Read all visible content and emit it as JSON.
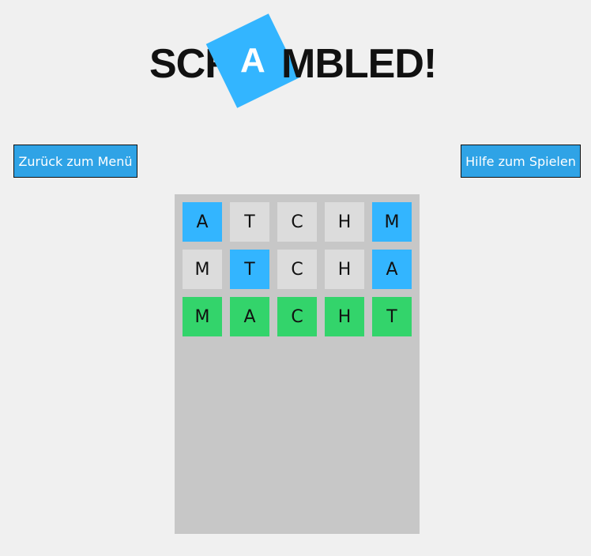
{
  "logo": {
    "text_left": "SCR",
    "tile_letter": "A",
    "text_right": "MBLED!"
  },
  "buttons": {
    "back_label": "Zurück zum Menü",
    "help_label": "Hilfe zum Spielen"
  },
  "colors": {
    "background": "#f0f0f0",
    "accent": "#33b5ff",
    "button": "#2fa3e6",
    "neutral_tile": "#dcdcdc",
    "correct_tile": "#33d46b",
    "board": "#c7c7c7"
  },
  "board": {
    "rows": [
      [
        {
          "letter": "A",
          "state": "accent"
        },
        {
          "letter": "T",
          "state": "neutral"
        },
        {
          "letter": "C",
          "state": "neutral"
        },
        {
          "letter": "H",
          "state": "neutral"
        },
        {
          "letter": "M",
          "state": "accent"
        }
      ],
      [
        {
          "letter": "M",
          "state": "neutral"
        },
        {
          "letter": "T",
          "state": "accent"
        },
        {
          "letter": "C",
          "state": "neutral"
        },
        {
          "letter": "H",
          "state": "neutral"
        },
        {
          "letter": "A",
          "state": "accent"
        }
      ],
      [
        {
          "letter": "M",
          "state": "correct"
        },
        {
          "letter": "A",
          "state": "correct"
        },
        {
          "letter": "C",
          "state": "correct"
        },
        {
          "letter": "H",
          "state": "correct"
        },
        {
          "letter": "T",
          "state": "correct"
        }
      ]
    ]
  }
}
